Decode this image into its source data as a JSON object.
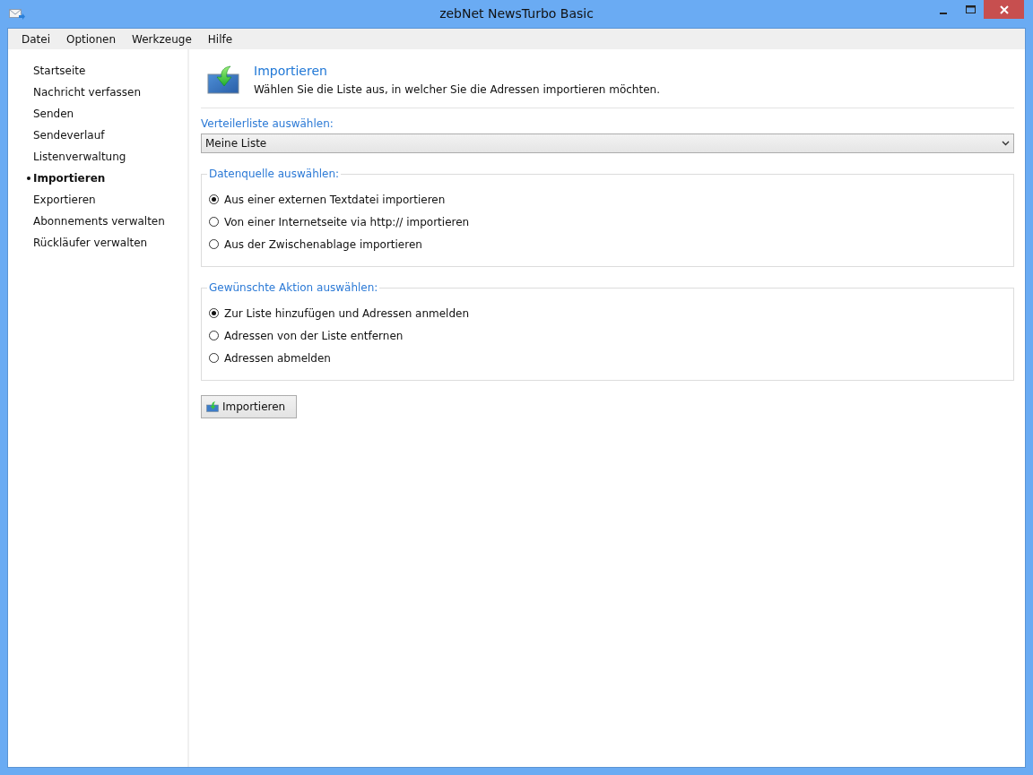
{
  "window": {
    "title": "zebNet NewsTurbo Basic"
  },
  "menu": [
    "Datei",
    "Optionen",
    "Werkzeuge",
    "Hilfe"
  ],
  "sidebar": {
    "items": [
      {
        "label": "Startseite",
        "selected": false
      },
      {
        "label": "Nachricht verfassen",
        "selected": false
      },
      {
        "label": "Senden",
        "selected": false
      },
      {
        "label": "Sendeverlauf",
        "selected": false
      },
      {
        "label": "Listenverwaltung",
        "selected": false
      },
      {
        "label": "Importieren",
        "selected": true
      },
      {
        "label": "Exportieren",
        "selected": false
      },
      {
        "label": "Abonnements verwalten",
        "selected": false
      },
      {
        "label": "Rückläufer verwalten",
        "selected": false
      }
    ]
  },
  "header": {
    "title": "Importieren",
    "description": "Wählen Sie die Liste aus, in welcher Sie die Adressen importieren möchten."
  },
  "list_select": {
    "label": "Verteilerliste auswählen:",
    "value": "Meine Liste"
  },
  "groups": [
    {
      "title": "Datenquelle auswählen:",
      "options": [
        {
          "label": "Aus einer externen Textdatei importieren",
          "selected": true
        },
        {
          "label": "Von einer Internetseite via http:// importieren",
          "selected": false
        },
        {
          "label": "Aus der Zwischenablage importieren",
          "selected": false
        }
      ]
    },
    {
      "title": "Gewünschte Aktion auswählen:",
      "options": [
        {
          "label": "Zur Liste hinzufügen und Adressen anmelden",
          "selected": true
        },
        {
          "label": "Adressen von der Liste entfernen",
          "selected": false
        },
        {
          "label": "Adressen abmelden",
          "selected": false
        }
      ]
    }
  ],
  "button": {
    "label": "Importieren"
  }
}
